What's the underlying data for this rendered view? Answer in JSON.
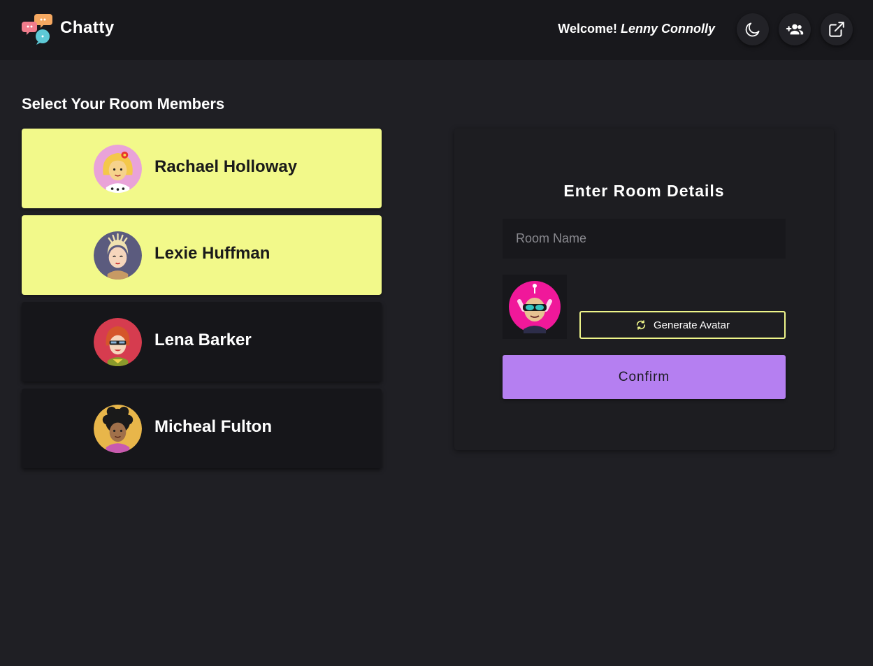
{
  "header": {
    "app_title": "Chatty",
    "welcome_label": "Welcome!",
    "user_name": "Lenny Connolly",
    "buttons": [
      {
        "icon": "moon-icon"
      },
      {
        "icon": "add-users-icon"
      },
      {
        "icon": "external-link-icon"
      }
    ]
  },
  "members_section": {
    "title": "Select Your Room Members",
    "members": [
      {
        "name": "Rachael Holloway",
        "selected": true
      },
      {
        "name": "Lexie Huffman",
        "selected": true
      },
      {
        "name": "Lena Barker",
        "selected": false
      },
      {
        "name": "Micheal Fulton",
        "selected": false
      }
    ]
  },
  "room_details": {
    "title": "Enter Room Details",
    "room_name_placeholder": "Room Name",
    "room_name_value": "",
    "generate_label": "Generate Avatar",
    "confirm_label": "Confirm"
  },
  "colors": {
    "background": "#1f1f24",
    "header": "#18181c",
    "selected_card": "#f2f98a",
    "accent_purple": "#b57ff1",
    "accent_yellow": "#eef58a"
  }
}
